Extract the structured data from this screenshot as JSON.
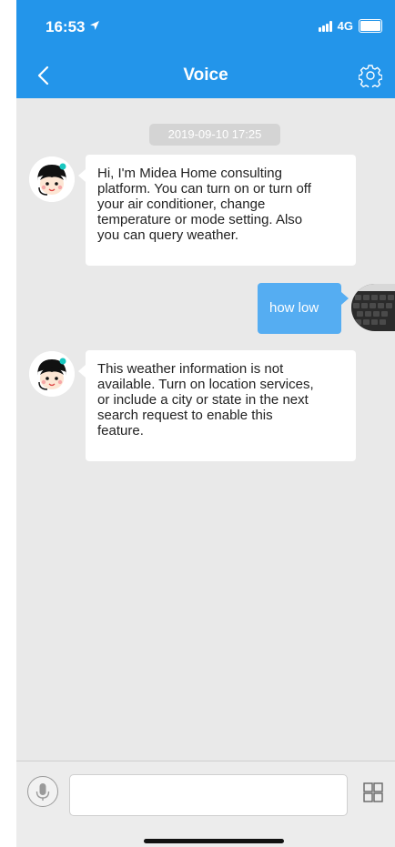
{
  "status_bar": {
    "time": "16:53",
    "network": "4G"
  },
  "header": {
    "title": "Voice"
  },
  "chat": {
    "timestamp": "2019-09-10 17:25",
    "messages": [
      {
        "sender": "bot",
        "lines": [
          "Hi, I'm Midea Home consulting",
          "platform. You can turn on or turn off",
          "your air conditioner, change",
          "temperature or mode setting. Also",
          "you can query weather."
        ]
      },
      {
        "sender": "user",
        "lines": [
          "how low"
        ]
      },
      {
        "sender": "bot",
        "lines": [
          "This weather information is not",
          "available. Turn on location services,",
          "or include a city or state in the next",
          "search request to enable this",
          "feature."
        ]
      }
    ]
  },
  "input_bar": {
    "placeholder": "",
    "value": ""
  },
  "icons": {
    "back": "chevron-left-icon",
    "settings": "gear-icon",
    "mic": "microphone-icon",
    "grid": "grid-icon",
    "location": "location-arrow-icon"
  },
  "colors": {
    "accent": "#2395ea",
    "user_bubble": "#55adf2",
    "background": "#e9e9e9"
  }
}
